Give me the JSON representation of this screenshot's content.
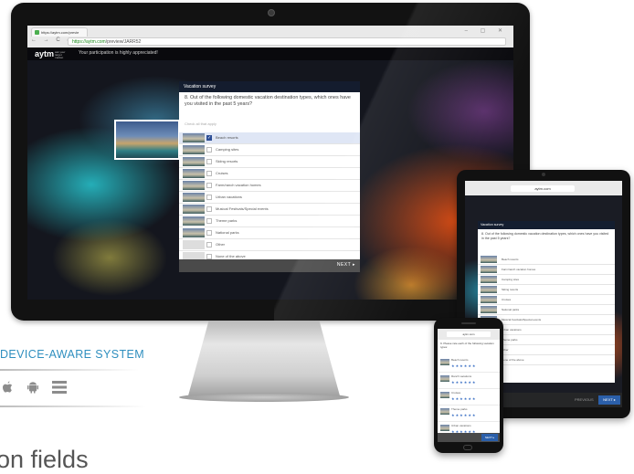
{
  "browser": {
    "tab_label": "https://aytm.com/previe",
    "url_secure": "https://aytm.com",
    "url_path": "/preview/JARR52",
    "nav_glyphs": "← → C ⌂",
    "window_controls": "– ▢ ✕"
  },
  "app": {
    "logo": "aytm",
    "logo_sub": "ask your target market",
    "message": "Your participation is highly appreciated!"
  },
  "survey": {
    "title": "Vacation survey",
    "question": "8. Out of the following domestic vacation destination types, which ones have you visited in the past 5 years?",
    "hint": "Check all that apply",
    "options": [
      {
        "label": "Beach resorts",
        "selected": true
      },
      {
        "label": "Camping sites",
        "selected": false
      },
      {
        "label": "Skiing resorts",
        "selected": false
      },
      {
        "label": "Cruises",
        "selected": false
      },
      {
        "label": "Farm/ranch vacation homes",
        "selected": false
      },
      {
        "label": "Urban vacations",
        "selected": false
      },
      {
        "label": "Musical Festivals/Special events",
        "selected": false
      },
      {
        "label": "Theme parks",
        "selected": false
      },
      {
        "label": "National parks",
        "selected": false
      },
      {
        "label": "Other",
        "selected": false
      },
      {
        "label": "None of the above",
        "selected": false
      }
    ],
    "next": "NEXT ▸"
  },
  "tagline": "DEVICE-AWARE SYSTEM",
  "os_icons": [
    "apple-icon",
    "android-icon",
    "windows-icon"
  ],
  "os_glyphs": " ",
  "bottom_text": "on fields",
  "ipad": {
    "url": "aytm.com",
    "title": "Vacation survey",
    "question": "8. Out of the following domestic vacation destination types, which ones have you visited in the past 5 years?",
    "options": [
      "Beach resorts",
      "Farm/ranch vacation homes",
      "Camping sites",
      "Skiing resorts",
      "Cruises",
      "National parks",
      "Musical Festivals/Special events",
      "Urban vacations",
      "Theme parks",
      "Other",
      "None of the above"
    ],
    "prev": "PREVIOUS",
    "next": "NEXT ▸"
  },
  "iphone": {
    "url": "aytm.com",
    "question": "9. Please rate each of the following vacation types:",
    "rows": [
      "Beach resorts",
      "Ranch vacations",
      "Cruises",
      "Theme parks",
      "Urban vacations"
    ],
    "stars": "★★★★★★",
    "next": "NEXT ▸"
  },
  "colors": {
    "accent": "#2f8fbf",
    "button": "#2b5faa",
    "selected_row": "#dfe6f5"
  }
}
